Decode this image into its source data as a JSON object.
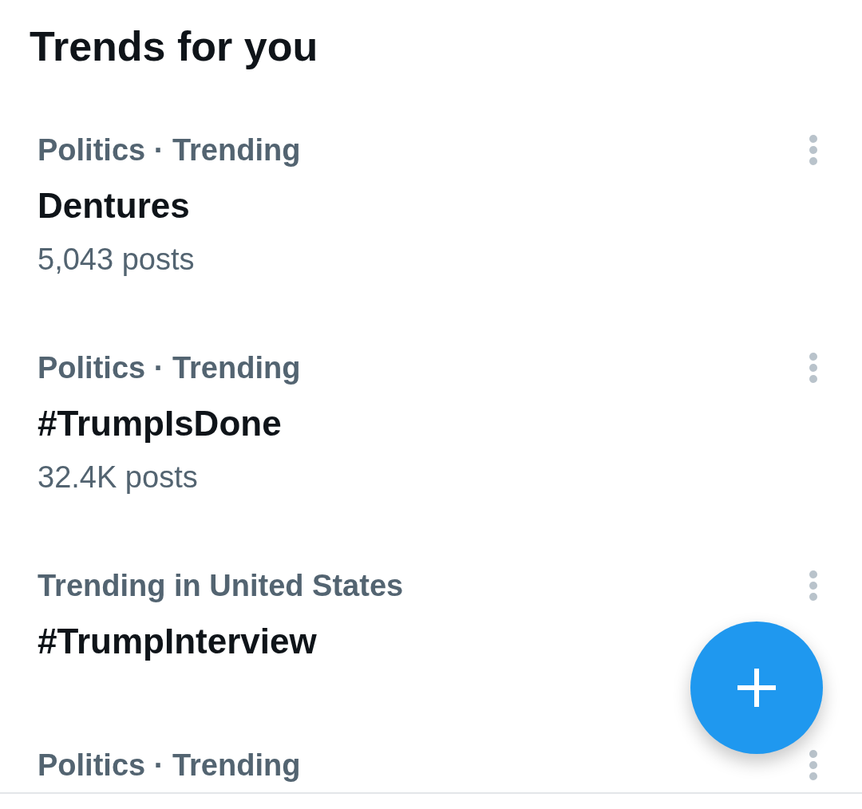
{
  "header": {
    "title": "Trends for you"
  },
  "trends": [
    {
      "context": "Politics · Trending",
      "name": "Dentures",
      "posts": "5,043 posts"
    },
    {
      "context": "Politics · Trending",
      "name": "#TrumpIsDone",
      "posts": "32.4K posts"
    },
    {
      "context": "Trending in United States",
      "name": "#TrumpInterview"
    },
    {
      "context": "Politics · Trending"
    }
  ]
}
